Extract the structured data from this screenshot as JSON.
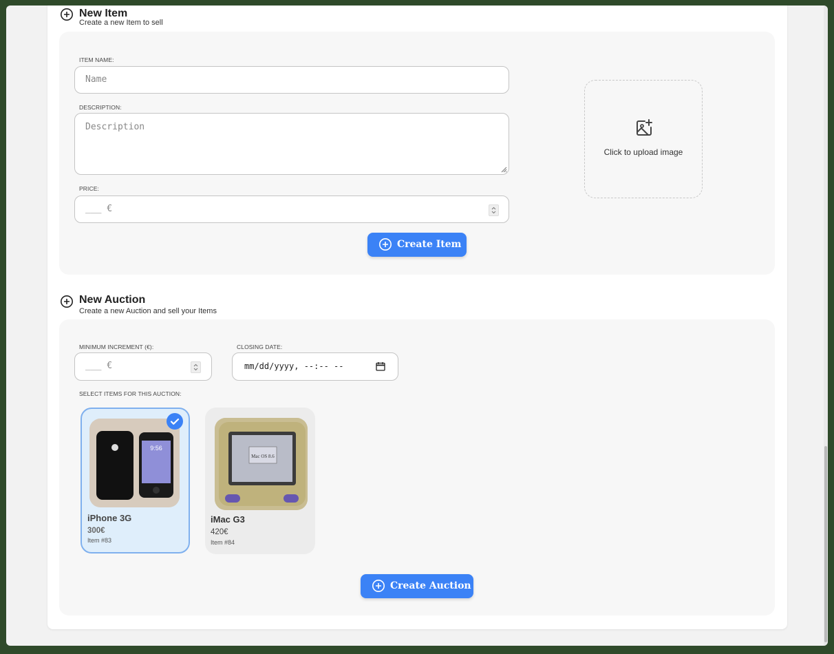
{
  "new_item": {
    "title": "New Item",
    "subtitle": "Create a new Item to sell",
    "name_label": "ITEM NAME:",
    "name_placeholder": "Name",
    "description_label": "DESCRIPTION:",
    "description_placeholder": "Description",
    "price_label": "PRICE:",
    "price_placeholder": "___ €",
    "upload_text": "Click to upload image",
    "create_button": "Create Item"
  },
  "new_auction": {
    "title": "New Auction",
    "subtitle": "Create a new Auction and sell your Items",
    "increment_label": "MINIMUM INCREMENT (€):",
    "increment_placeholder": "___ €",
    "closing_label": "CLOSING DATE:",
    "closing_placeholder": "mm/dd/yyyy, --:-- --",
    "select_label": "SELECT ITEMS FOR THIS AUCTION:",
    "items": [
      {
        "name": "iPhone 3G",
        "price": "300€",
        "id": "Item #83",
        "selected": true
      },
      {
        "name": "iMac G3",
        "price": "420€",
        "id": "Item #84",
        "selected": false
      }
    ],
    "create_button": "Create Auction"
  },
  "icons": [
    "plus-circle-icon",
    "image-plus-icon",
    "calendar-icon",
    "check-icon"
  ],
  "colors": {
    "accent": "#3b82f6",
    "selected_bg": "#dfeefb",
    "panel": "#f7f7f7"
  }
}
